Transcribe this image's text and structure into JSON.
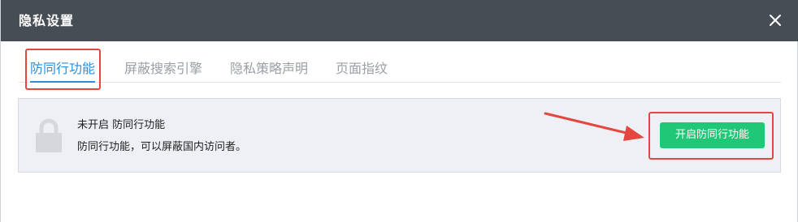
{
  "dialog": {
    "title": "隐私设置",
    "close_icon": "close-icon"
  },
  "tabs": [
    {
      "label": "防同行功能",
      "active": true
    },
    {
      "label": "屏蔽搜索引擎",
      "active": false
    },
    {
      "label": "隐私策略声明",
      "active": false
    },
    {
      "label": "页面指纹",
      "active": false
    }
  ],
  "panel": {
    "icon": "lock-icon",
    "status": "未开启 防同行功能",
    "description": "防同行功能，可以屏蔽国内访问者。"
  },
  "action": {
    "button_label": "开启防同行功能",
    "button_color": "#1fc876"
  },
  "annotations": {
    "highlight_color": "#e4473f"
  }
}
